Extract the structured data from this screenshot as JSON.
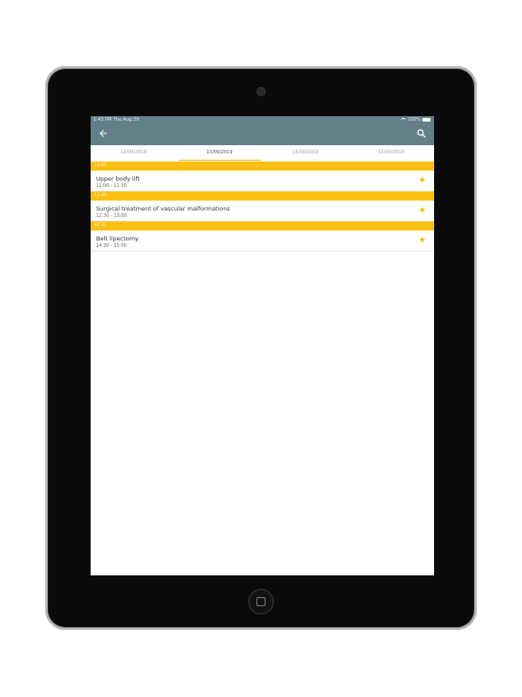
{
  "status": {
    "time": "1:43 PM",
    "date": "Thu Aug 29",
    "battery": "100%"
  },
  "tabs": [
    {
      "label": "12/09/2019"
    },
    {
      "label": "13/09/2019"
    },
    {
      "label": "14/09/2019"
    },
    {
      "label": "15/09/2019"
    }
  ],
  "active_tab": 1,
  "sessions": [
    {
      "header": "11:00",
      "title": "Upper body lift",
      "time": "11:00 - 11:30"
    },
    {
      "header": "12:30",
      "title": "Surgical treatment of vascular malformations",
      "time": "12:30 - 13:00"
    },
    {
      "header": "14:30",
      "title": "Belt lipectomy",
      "time": "14:30 - 15:00"
    }
  ],
  "colors": {
    "appbar": "#637f8a",
    "accent": "#fcc013",
    "star": "#f6b400"
  },
  "icons": {
    "back": "arrow-left-icon",
    "search": "search-icon",
    "favorite": "star-icon"
  }
}
